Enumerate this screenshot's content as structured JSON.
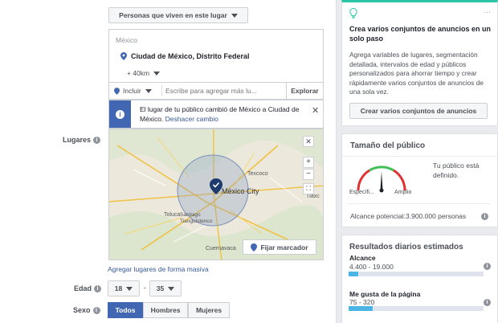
{
  "targeting": {
    "location_type": "Personas que viven en este lugar",
    "country_label": "México",
    "selected_location": "Ciudad de México, Distrito Federal",
    "radius": "+ 40km",
    "include_label": "Incluir",
    "search_placeholder": "Escribe para agregar más lu...",
    "explore_label": "Explorar",
    "notice_text": "El lugar de tu público cambió de México a Ciudad de México.",
    "notice_undo": "Deshacer cambio",
    "map": {
      "city_label": "México City",
      "labels": [
        "Texcoco",
        "Toluca",
        "Santiago Tianguistenco",
        "Cuernavaca",
        "Tlaxc"
      ],
      "pin_button": "Fijar marcador"
    },
    "bulk_link": "Agregar lugares de forma masiva",
    "places_label": "Lugares",
    "age_label": "Edad",
    "age_min": "18",
    "age_sep": "-",
    "age_max": "35",
    "sex_label": "Sexo",
    "sex_options": [
      "Todos",
      "Hombres",
      "Mujeres"
    ],
    "sex_selected": "Todos"
  },
  "sidebar": {
    "tip": {
      "title": "Crea varios conjuntos de anuncios en un solo paso",
      "body": "Agrega variables de lugares, segmentación detallada, intervalos de edad y públicos personalizados para ahorrar tiempo y crear rápidamente varios conjuntos de anuncios de una sola vez.",
      "button": "Crear varios conjuntos de anuncios",
      "more": "···"
    },
    "audience": {
      "title": "Tamaño del público",
      "gauge_left": "Específi...",
      "gauge_right": "Amplio",
      "status": "Tu público está definido.",
      "reach_label": "Alcance potencial:",
      "reach_value": "3.900.000 personas",
      "gauge_level": 0.5
    },
    "results": {
      "title": "Resultados diarios estimados",
      "metrics": [
        {
          "label": "Alcance",
          "value": "4.400 - 19.000",
          "fill": 0.07
        },
        {
          "label": "Me gusta de la página",
          "value": "75 - 320",
          "fill": 0.18
        }
      ]
    }
  },
  "colors": {
    "accent": "#4267b2",
    "teal": "#29c5a4",
    "link": "#365899"
  }
}
